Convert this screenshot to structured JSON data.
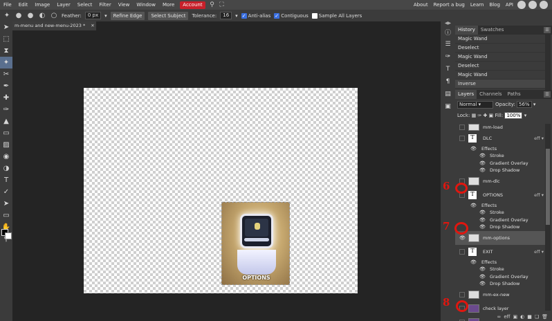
{
  "menubar": {
    "items": [
      "File",
      "Edit",
      "Image",
      "Layer",
      "Select",
      "Filter",
      "View",
      "Window",
      "More"
    ],
    "account": "Account",
    "right_links": [
      "About",
      "Report a bug",
      "Learn",
      "Blog",
      "API"
    ]
  },
  "options": {
    "feather_label": "Feather:",
    "feather_value": "0 px",
    "refine_edge": "Refine Edge",
    "select_subject": "Select Subject",
    "tolerance_label": "Tolerance:",
    "tolerance_value": "16",
    "anti_alias": "Anti-alias",
    "contiguous": "Contiguous",
    "sample_all_layers": "Sample All Layers"
  },
  "document": {
    "tab_title": "m-menu and new-menu-2023",
    "tab_modified": "*",
    "canvas_caption": "OPTIONS"
  },
  "history": {
    "tabs": [
      "History",
      "Swatches"
    ],
    "entries": [
      "Magic Wand",
      "Deselect",
      "Magic Wand",
      "Deselect",
      "Magic Wand",
      "Inverse"
    ]
  },
  "layers_panel": {
    "tabs": [
      "Layers",
      "Channels",
      "Paths"
    ],
    "blend_mode": "Normal",
    "opacity_label": "Opacity:",
    "opacity_value": "56%",
    "lock_label": "Lock:",
    "fill_label": "Fill:",
    "fill_value": "100%",
    "fx_label": "eff",
    "effects_label": "Effects",
    "stroke": "Stroke",
    "gradient_overlay": "Gradient Overlay",
    "drop_shadow": "Drop Shadow",
    "layers": {
      "mm_load": "mm-load",
      "dlc": "DLC",
      "mm_dlc": "mm-dlc",
      "options": "OPTIONS",
      "mm_options": "mm-options",
      "exit": "EXIT",
      "mm_ex_new": "mm-ex-new",
      "check_layer": "check layer",
      "m_menu_new": "m-menu-new"
    }
  },
  "annotations": {
    "six": "6",
    "seven": "7",
    "eight": "8"
  }
}
